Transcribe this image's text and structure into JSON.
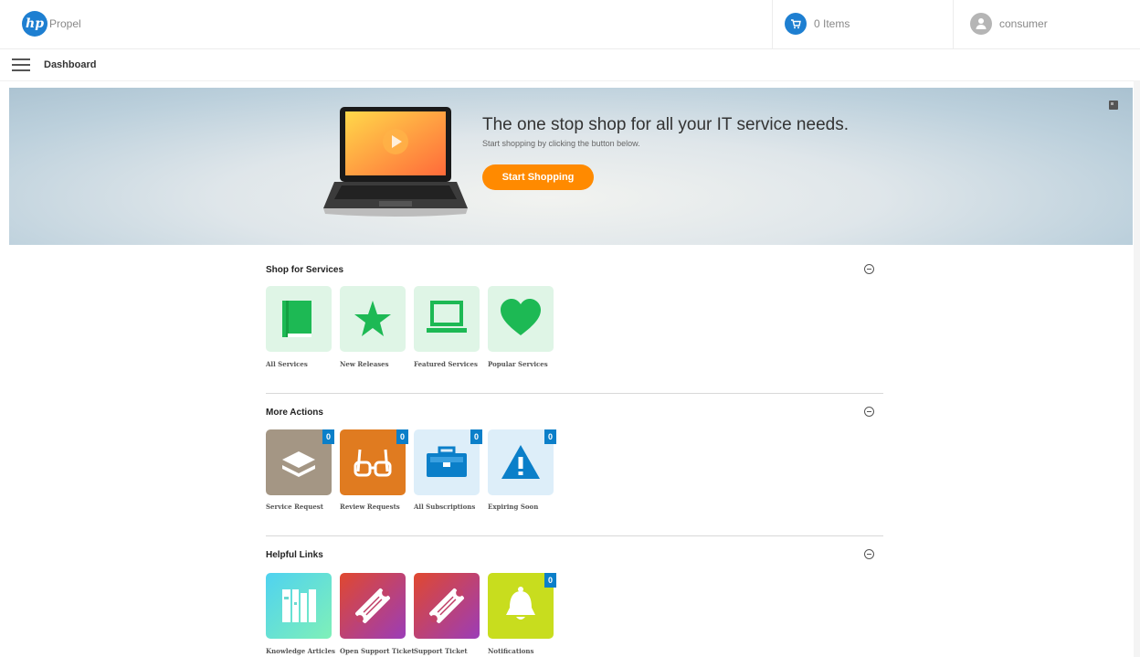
{
  "header": {
    "logo_text": "hp",
    "app_name": "Propel",
    "cart_label": "0 Items",
    "user_name": "consumer"
  },
  "subbar": {
    "breadcrumb": "Dashboard"
  },
  "hero": {
    "title": "The one stop shop for all your IT service needs.",
    "subtitle": "Start shopping by clicking the button below.",
    "button": "Start Shopping"
  },
  "sections": {
    "shop": {
      "title": "Shop for Services",
      "tiles": [
        {
          "label": "All Services",
          "icon": "book-icon"
        },
        {
          "label": "New Releases",
          "icon": "star-icon"
        },
        {
          "label": "Featured Services",
          "icon": "laptop-icon"
        },
        {
          "label": "Popular Services",
          "icon": "heart-icon"
        }
      ]
    },
    "actions": {
      "title": "More Actions",
      "tiles": [
        {
          "label": "Service Request",
          "icon": "layers-icon",
          "badge": "0"
        },
        {
          "label": "Review Requests",
          "icon": "glasses-icon",
          "badge": "0"
        },
        {
          "label": "All Subscriptions",
          "icon": "briefcase-icon",
          "badge": "0"
        },
        {
          "label": "Expiring Soon",
          "icon": "warning-icon",
          "badge": "0"
        }
      ]
    },
    "links": {
      "title": "Helpful Links",
      "tiles": [
        {
          "label": "Knowledge Articles",
          "icon": "books-icon"
        },
        {
          "label": "Open Support Ticket",
          "icon": "ticket-icon"
        },
        {
          "label": "Support Ticket",
          "icon": "ticket-icon"
        },
        {
          "label": "Notifications",
          "icon": "bell-icon",
          "badge": "0"
        }
      ]
    }
  },
  "colors": {
    "brand_blue": "#1e7fd1",
    "accent_orange": "#ff8a00",
    "shop_green": "#1db954",
    "badge_blue": "#0b7fc9"
  }
}
